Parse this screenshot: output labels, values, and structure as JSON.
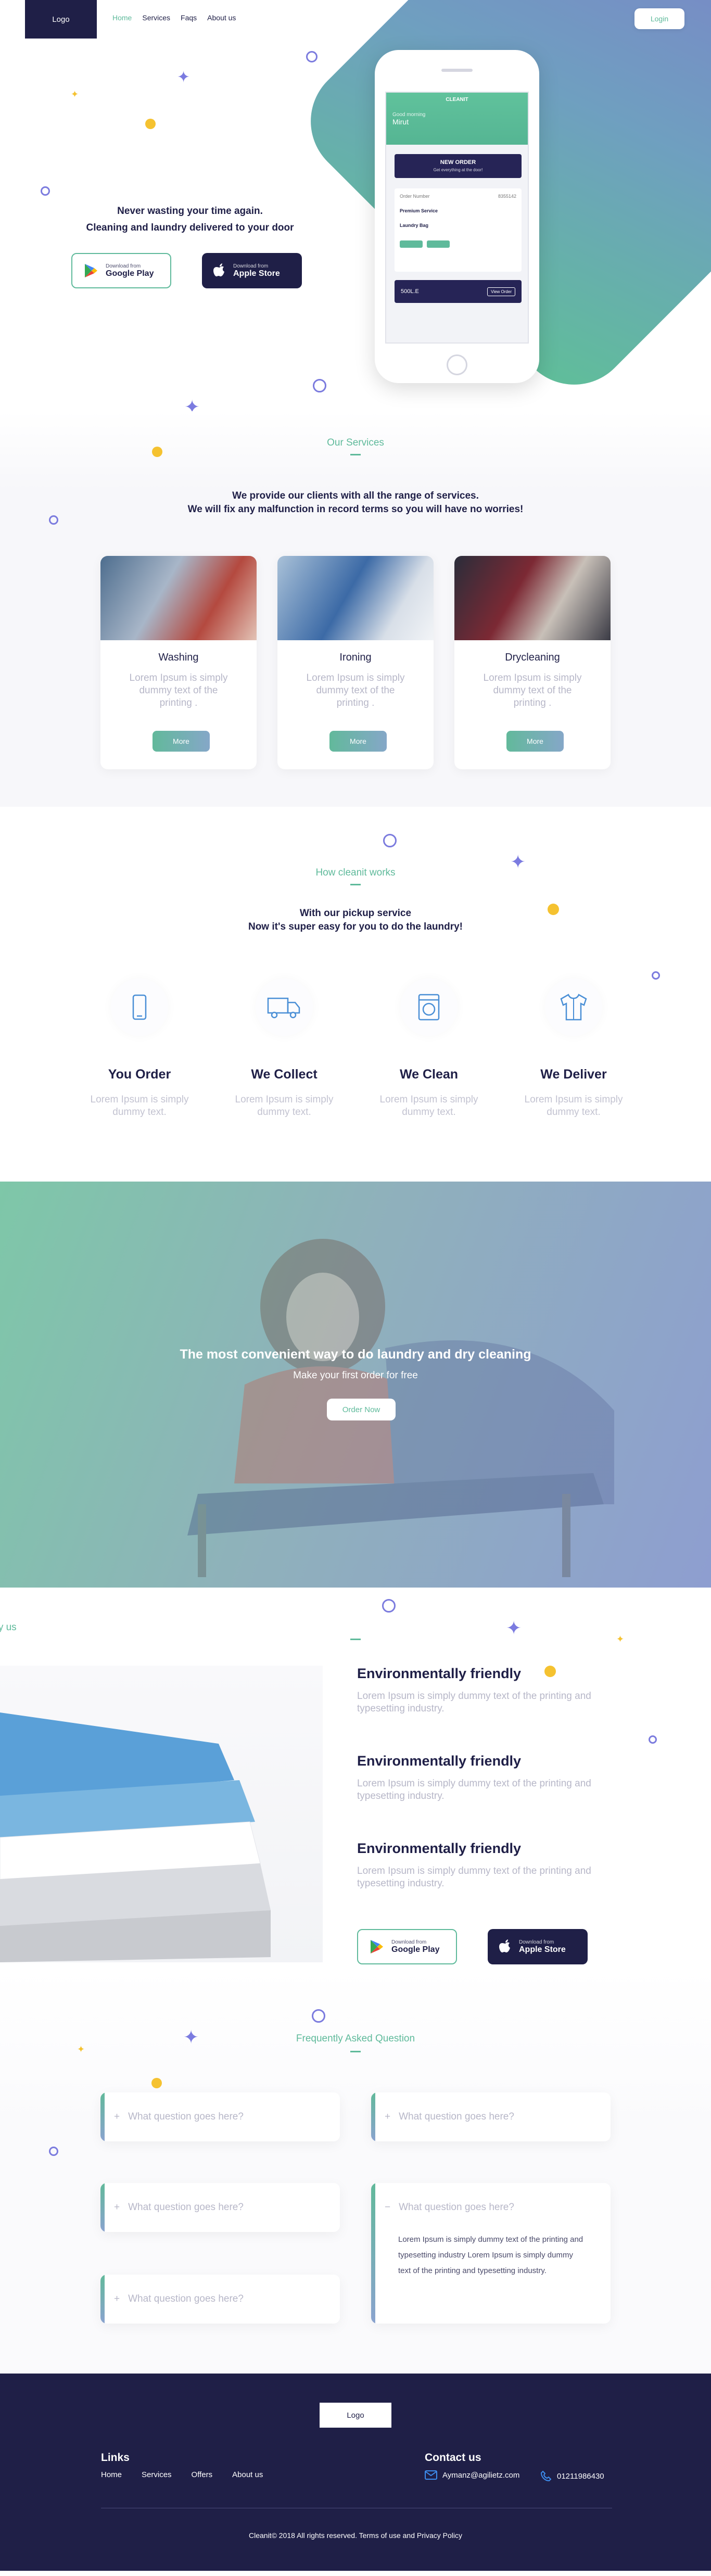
{
  "header": {
    "logo": "Logo",
    "nav": [
      "Home",
      "Services",
      "Faqs",
      "About us"
    ],
    "login": "Login"
  },
  "hero": {
    "line1": "Never wasting your time again.",
    "line2": "Cleaning and laundry delivered to your door",
    "google_small": "Download from",
    "google_big": "Google Play",
    "apple_small": "Download from",
    "apple_big": "Apple Store",
    "phone": {
      "app_title": "CLEANIT",
      "greeting_label": "Good morning",
      "user_name": "Mirut",
      "new_order": "NEW ORDER",
      "new_order_sub": "Get everything at the door!",
      "order_number_label": "Order Number",
      "order_number": "8355142",
      "premium": "Premium Service",
      "laundry_bag": "Laundry Bag",
      "total": "500L.E",
      "view_order": "View Order"
    }
  },
  "services": {
    "title": "Our Services",
    "sub1": "We provide our clients with all the range of services.",
    "sub2": "We will fix any malfunction in record terms so you will have no worries!",
    "cards": [
      {
        "name": "Washing",
        "desc": "Lorem Ipsum is simply dummy text of the printing .",
        "button": "More"
      },
      {
        "name": "Ironing",
        "desc": "Lorem Ipsum is simply dummy text of the printing .",
        "button": "More"
      },
      {
        "name": "Drycleaning",
        "desc": "Lorem Ipsum is simply dummy text of the printing .",
        "button": "More"
      }
    ]
  },
  "how": {
    "title": "How cleanit works",
    "sub1": "With our pickup service",
    "sub2": "Now it's super easy for you to do the laundry!",
    "steps": [
      {
        "title": "You Order",
        "desc": "Lorem Ipsum is simply dummy text.",
        "icon": "phone-icon"
      },
      {
        "title": "We Collect",
        "desc": "Lorem Ipsum is simply dummy text.",
        "icon": "truck-icon"
      },
      {
        "title": "We Clean",
        "desc": "Lorem Ipsum is simply dummy text.",
        "icon": "washing-machine-icon"
      },
      {
        "title": "We Deliver",
        "desc": "Lorem Ipsum is simply dummy text.",
        "icon": "shirt-icon"
      }
    ]
  },
  "banner": {
    "title": "The most convenient way to do laundry and dry cleaning",
    "sub": "Make your first order for free",
    "button": "Order Now"
  },
  "why": {
    "title": "Why us",
    "items": [
      {
        "title": "Environmentally friendly",
        "desc": "Lorem Ipsum is simply dummy text of the printing and typesetting industry."
      },
      {
        "title": "Environmentally friendly",
        "desc": "Lorem Ipsum is simply dummy text of the printing and typesetting industry."
      },
      {
        "title": "Environmentally friendly",
        "desc": "Lorem Ipsum is simply dummy text of the printing and typesetting industry."
      }
    ],
    "google_small": "Download from",
    "google_big": "Google Play",
    "apple_small": "Download from",
    "apple_big": "Apple Store"
  },
  "faq": {
    "title": "Frequently Asked Question",
    "items": [
      {
        "q": "What question goes here?",
        "open": false
      },
      {
        "q": "What question goes here?",
        "open": false
      },
      {
        "q": "What question goes here?",
        "open": false
      },
      {
        "q": "What question goes here?",
        "open": true,
        "a": "Lorem Ipsum is simply dummy text of the printing and typesetting industry Lorem Ipsum is simply dummy text of the printing and typesetting industry."
      },
      {
        "q": "What question goes here?",
        "open": false
      }
    ]
  },
  "footer": {
    "logo": "Logo",
    "links_title": "Links",
    "links": [
      "Home",
      "Services",
      "Offers",
      "About us"
    ],
    "contact_title": "Contact us",
    "email": "Aymanz@agilietz.com",
    "phone": "01211986430",
    "copyright": "Cleanit© 2018 All rights reserved. Terms of use and Privacy Policy"
  },
  "colors": {
    "navy": "#1f1f47",
    "green": "#5fba9b",
    "purple": "#7b7bde",
    "yellow": "#f5c230"
  }
}
